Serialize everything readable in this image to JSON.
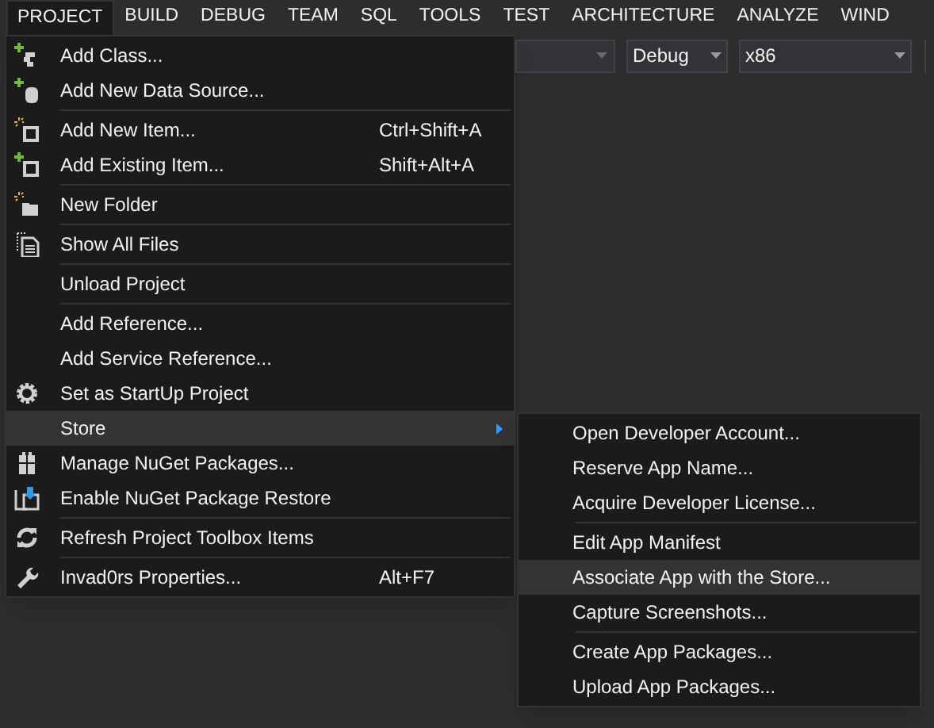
{
  "menubar": [
    {
      "label": "PROJECT",
      "selected": true
    },
    {
      "label": "BUILD",
      "selected": false
    },
    {
      "label": "DEBUG",
      "selected": false
    },
    {
      "label": "TEAM",
      "selected": false
    },
    {
      "label": "SQL",
      "selected": false
    },
    {
      "label": "TOOLS",
      "selected": false
    },
    {
      "label": "TEST",
      "selected": false
    },
    {
      "label": "ARCHITECTURE",
      "selected": false
    },
    {
      "label": "ANALYZE",
      "selected": false
    },
    {
      "label": "WIND",
      "selected": false
    }
  ],
  "toolbar": {
    "dropdowns": [
      {
        "value": "Debug"
      },
      {
        "value": "x86"
      }
    ]
  },
  "project_menu": [
    {
      "kind": "item",
      "label": "Add Class...",
      "selected": false
    },
    {
      "kind": "item",
      "label": "Add New Data Source...",
      "selected": false
    },
    {
      "kind": "separator"
    },
    {
      "kind": "item",
      "label": "Add New Item...",
      "shortcut": "Ctrl+Shift+A",
      "selected": false
    },
    {
      "kind": "item",
      "label": "Add Existing Item...",
      "shortcut": "Shift+Alt+A",
      "selected": false
    },
    {
      "kind": "separator"
    },
    {
      "kind": "item",
      "label": "New Folder",
      "selected": false
    },
    {
      "kind": "separator"
    },
    {
      "kind": "item",
      "label": "Show All Files",
      "selected": false
    },
    {
      "kind": "separator"
    },
    {
      "kind": "item",
      "label": "Unload Project",
      "selected": false
    },
    {
      "kind": "separator"
    },
    {
      "kind": "item",
      "label": "Add Reference...",
      "selected": false
    },
    {
      "kind": "item",
      "label": "Add Service Reference...",
      "selected": false
    },
    {
      "kind": "item",
      "label": "Set as StartUp Project",
      "selected": false
    },
    {
      "kind": "submenu",
      "label": "Store",
      "selected": true
    },
    {
      "kind": "item",
      "label": "Manage NuGet Packages...",
      "selected": false
    },
    {
      "kind": "item",
      "label": "Enable NuGet Package Restore",
      "selected": false
    },
    {
      "kind": "separator"
    },
    {
      "kind": "item",
      "label": "Refresh Project Toolbox Items",
      "selected": false
    },
    {
      "kind": "separator"
    },
    {
      "kind": "item",
      "label": "Invad0rs Properties...",
      "shortcut": "Alt+F7",
      "selected": false
    }
  ],
  "store_submenu": [
    {
      "kind": "item",
      "label": "Open Developer Account...",
      "selected": false
    },
    {
      "kind": "item",
      "label": "Reserve App Name...",
      "selected": false
    },
    {
      "kind": "item",
      "label": "Acquire Developer License...",
      "selected": false
    },
    {
      "kind": "separator"
    },
    {
      "kind": "item",
      "label": "Edit App Manifest",
      "selected": false
    },
    {
      "kind": "item",
      "label": "Associate App with the Store...",
      "selected": true
    },
    {
      "kind": "item",
      "label": "Capture Screenshots...",
      "selected": false
    },
    {
      "kind": "separator"
    },
    {
      "kind": "item",
      "label": "Create App Packages...",
      "selected": false
    },
    {
      "kind": "item",
      "label": "Upload App Packages...",
      "selected": false
    }
  ]
}
